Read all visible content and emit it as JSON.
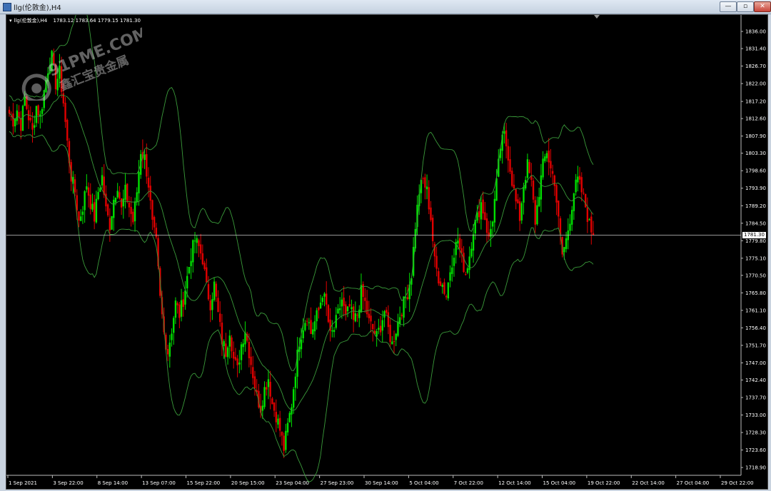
{
  "window": {
    "title": "llg(伦敦金),H4",
    "buttons": {
      "minimize": "—",
      "maximize": "▫",
      "close": "✕"
    }
  },
  "header": {
    "symbol": "llg(伦敦金),H4",
    "ohlc": "1783.12 1783.64 1779.15 1781.30"
  },
  "current_price_label": "1781.30",
  "watermark": {
    "line1": "91PME.COM",
    "line2": "鑫汇宝贵金属"
  },
  "colors": {
    "background": "#000000",
    "bull": "#00e000",
    "bear": "#e00000",
    "bands": "#3a9a3a",
    "grid_line": "#c8c8c8",
    "axis_text": "#ffffff"
  },
  "chart_data": {
    "type": "candlestick",
    "timeframe": "H4",
    "ylim": [
      1716.0,
      1839.0
    ],
    "y_ticks": [
      "1836.00",
      "1831.40",
      "1826.70",
      "1822.00",
      "1817.20",
      "1812.60",
      "1807.90",
      "1803.30",
      "1798.60",
      "1793.90",
      "1789.20",
      "1784.50",
      "1779.80",
      "1775.10",
      "1770.50",
      "1765.80",
      "1761.10",
      "1756.40",
      "1751.70",
      "1747.00",
      "1742.40",
      "1737.70",
      "1733.00",
      "1728.30",
      "1723.60",
      "1718.90"
    ],
    "x_ticks": [
      "1 Sep 2021",
      "3 Sep 22:00",
      "8 Sep 14:00",
      "13 Sep 07:00",
      "15 Sep 22:00",
      "20 Sep 15:00",
      "23 Sep 04:00",
      "27 Sep 23:00",
      "30 Sep 14:00",
      "5 Oct 04:00",
      "7 Oct 22:00",
      "12 Oct 14:00",
      "15 Oct 04:00",
      "19 Oct 22:00",
      "22 Oct 14:00",
      "27 Oct 04:00",
      "29 Oct 22:00"
    ],
    "current_price": 1781.3,
    "close_path": [
      1814,
      1812,
      1815,
      1811,
      1818,
      1813,
      1809,
      1816,
      1813,
      1820,
      1826,
      1829,
      1822,
      1825,
      1817,
      1806,
      1797,
      1793,
      1785,
      1789,
      1795,
      1790,
      1786,
      1793,
      1797,
      1788,
      1784,
      1791,
      1795,
      1788,
      1793,
      1789,
      1785,
      1793,
      1804,
      1802,
      1795,
      1784,
      1779,
      1764,
      1755,
      1750,
      1756,
      1763,
      1760,
      1764,
      1770,
      1776,
      1780,
      1778,
      1775,
      1767,
      1763,
      1768,
      1760,
      1753,
      1750,
      1756,
      1748,
      1745,
      1752,
      1756,
      1750,
      1744,
      1738,
      1735,
      1740,
      1743,
      1736,
      1733,
      1729,
      1724,
      1730,
      1736,
      1745,
      1753,
      1757,
      1760,
      1755,
      1758,
      1761,
      1766,
      1762,
      1754,
      1756,
      1760,
      1764,
      1759,
      1762,
      1758,
      1760,
      1766,
      1763,
      1758,
      1756,
      1754,
      1757,
      1761,
      1756,
      1752,
      1756,
      1760,
      1763,
      1766,
      1771,
      1784,
      1793,
      1796,
      1793,
      1786,
      1774,
      1770,
      1768,
      1765,
      1772,
      1777,
      1780,
      1775,
      1771,
      1776,
      1783,
      1786,
      1790,
      1786,
      1780,
      1786,
      1795,
      1805,
      1808,
      1803,
      1796,
      1790,
      1786,
      1795,
      1800,
      1795,
      1785,
      1793,
      1800,
      1804,
      1799,
      1796,
      1785,
      1776,
      1780,
      1786,
      1793,
      1796,
      1793,
      1789,
      1784,
      1781.3
    ]
  }
}
